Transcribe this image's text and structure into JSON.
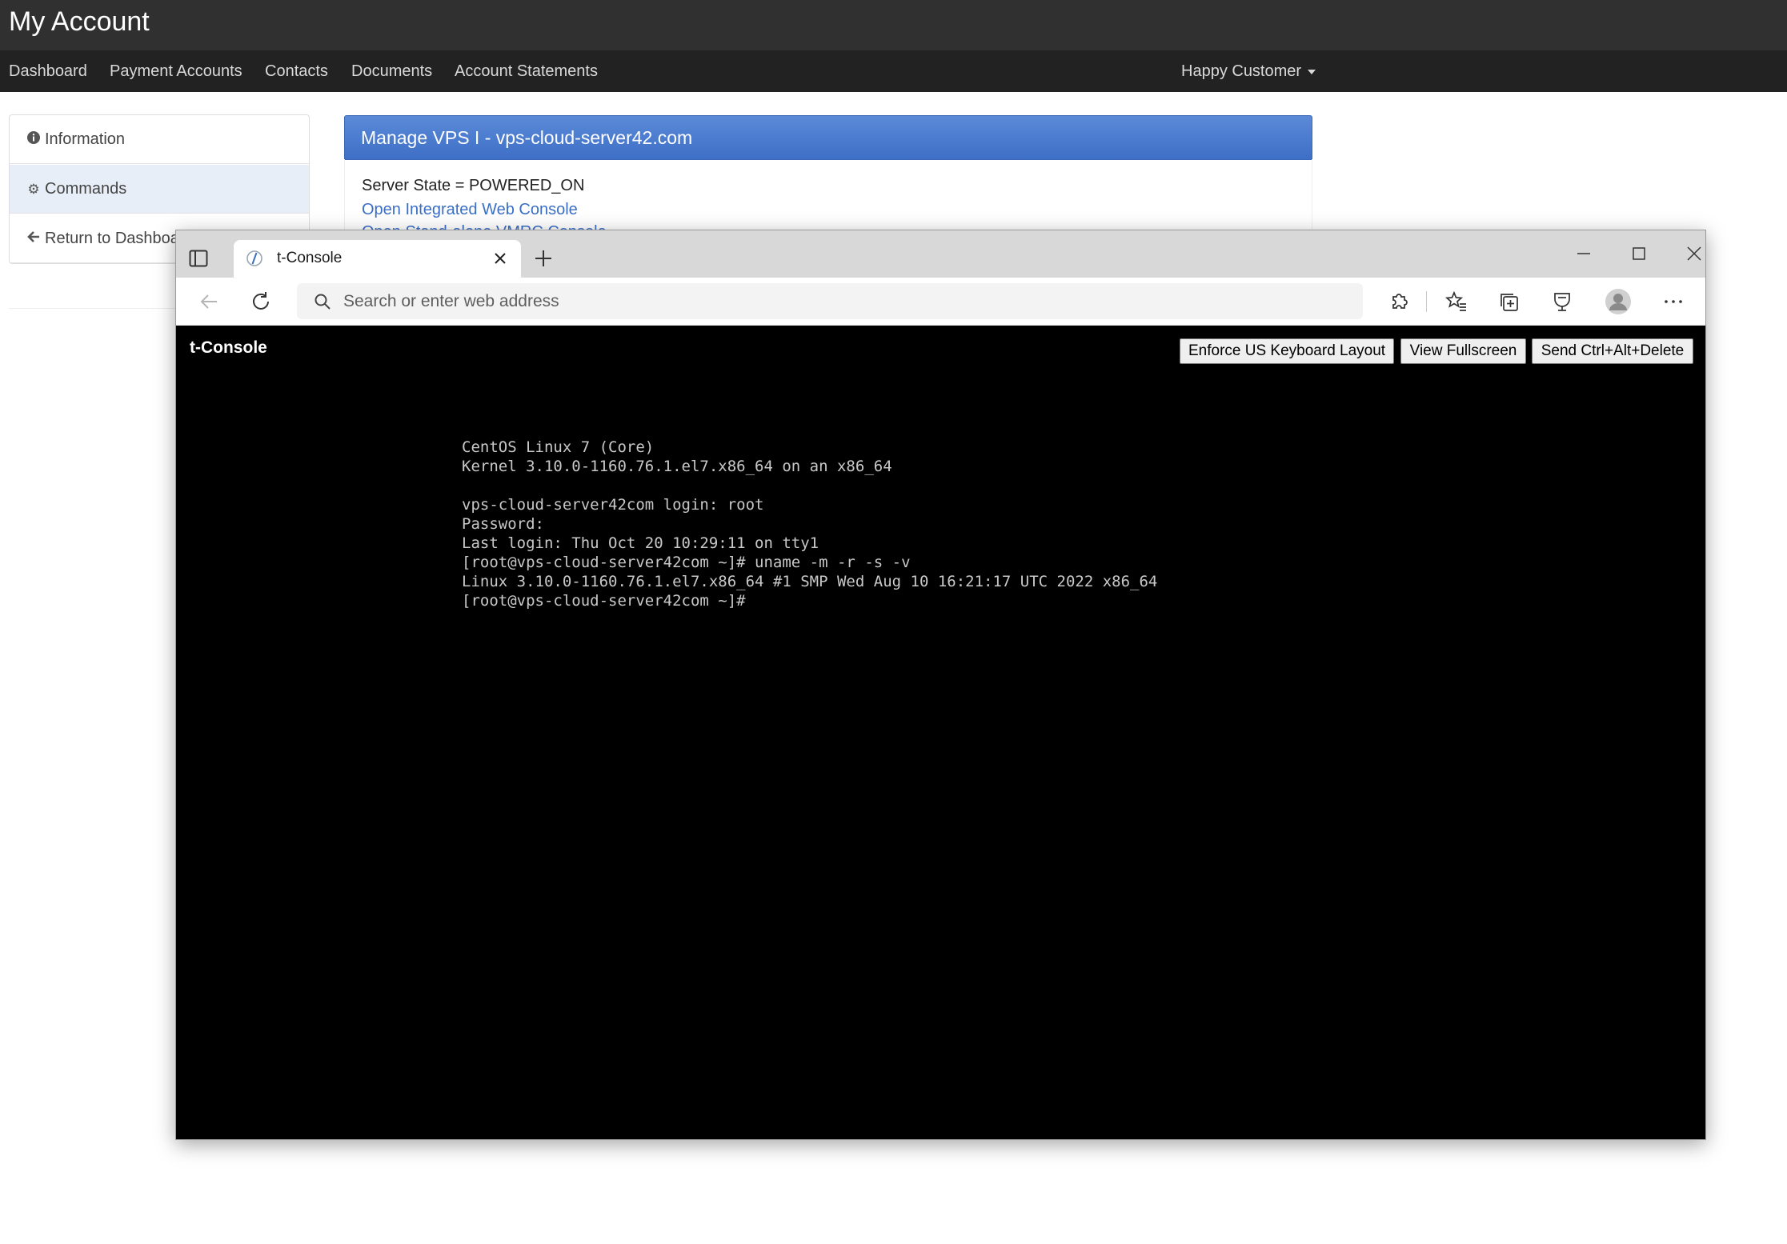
{
  "app": {
    "title": "My Account"
  },
  "nav": {
    "items": [
      "Dashboard",
      "Payment Accounts",
      "Contacts",
      "Documents",
      "Account Statements"
    ],
    "user_menu": "Happy Customer"
  },
  "sidebar": {
    "items": [
      {
        "label": "Information",
        "icon": "info-icon"
      },
      {
        "label": "Commands",
        "icon": "gear-icon"
      },
      {
        "label": "Return to Dashboard",
        "icon": "arrow-left-icon"
      }
    ]
  },
  "vps": {
    "title": "Manage VPS I - vps-cloud-server42.com",
    "server_state": "Server State = POWERED_ON",
    "links": [
      "Open Integrated Web Console",
      "Open Stand-alone VMRC Console"
    ],
    "header_color": "#4a7bd0"
  },
  "browser": {
    "tab_title": "t-Console",
    "address_placeholder": "Search or enter web address"
  },
  "console": {
    "title": "t-Console",
    "buttons": [
      "Enforce US Keyboard Layout",
      "View Fullscreen",
      "Send Ctrl+Alt+Delete"
    ],
    "lines": [
      "CentOS Linux 7 (Core)",
      "Kernel 3.10.0-1160.76.1.el7.x86_64 on an x86_64",
      "",
      "vps-cloud-server42com login: root",
      "Password:",
      "Last login: Thu Oct 20 10:29:11 on tty1",
      "[root@vps-cloud-server42com ~]# uname -m -r -s -v",
      "Linux 3.10.0-1160.76.1.el7.x86_64 #1 SMP Wed Aug 10 16:21:17 UTC 2022 x86_64",
      "[root@vps-cloud-server42com ~]#"
    ]
  }
}
